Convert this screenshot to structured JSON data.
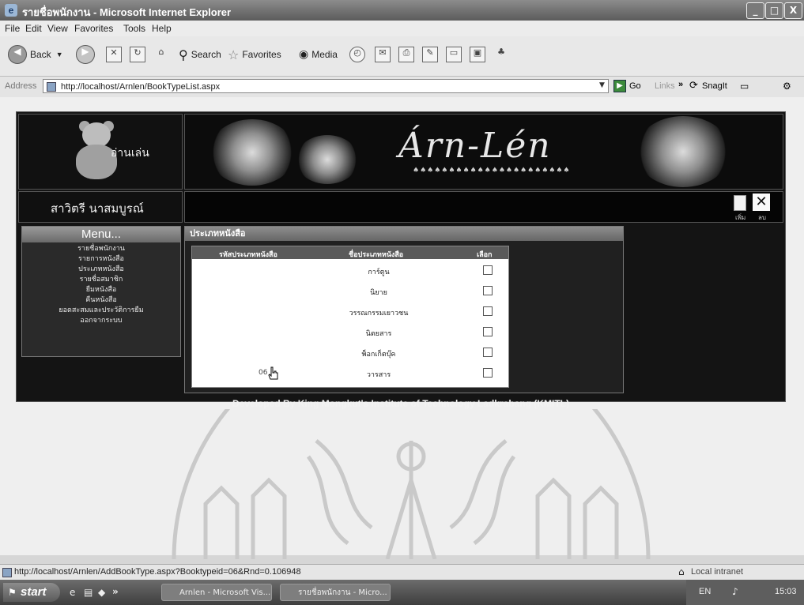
{
  "window": {
    "title": "รายชื่อพนักงาน - Microsoft Internet Explorer",
    "buttons": [
      "_",
      "□",
      "X"
    ]
  },
  "menubar": [
    "File",
    "Edit",
    "View",
    "Favorites",
    "Tools",
    "Help"
  ],
  "toolbar": {
    "back_label": "Back",
    "search_label": "Search",
    "favorites_label": "Favorites",
    "media_label": "Media"
  },
  "address": {
    "label": "Address",
    "url": "http://localhost/Arnlen/BookTypeList.aspx",
    "go_label": "Go",
    "links_label": "Links",
    "snagit_label": "SnagIt"
  },
  "site": {
    "logo_text": "อ่านเล่น",
    "banner_title": "Árn-Lén",
    "banner_dots": "♠♠♠♠♠♠♠♠♠♠♠♠♠♠♠♠♠♠♠♠♠♠",
    "user_name": "สาวิตรี นาสมบูรณ์",
    "add_label": "เพิ่ม",
    "delete_label": "ลบ",
    "menu_title": "Menu...",
    "menu_items": [
      "รายชื่อพนักงาน",
      "รายการหนังสือ",
      "ประเภทหนังสือ",
      "รายชื่อสมาชิก",
      "ยืมหนังสือ",
      "คืนหนังสือ",
      "ยอดสะสมและประวัติการยืม",
      "ออกจากระบบ"
    ],
    "content_title": "ประเภทหนังสือ",
    "table": {
      "headers": [
        "รหัสประเภทหนังสือ",
        "ชื่อประเภทหนังสือ",
        "เลือก"
      ],
      "rows": [
        {
          "name": "การ์ตูน",
          "selected": false
        },
        {
          "name": "นิยาย",
          "selected": false
        },
        {
          "name": "วรรณกรรมเยาวชน",
          "selected": false
        },
        {
          "name": "นิตยสาร",
          "selected": false
        },
        {
          "name": "พ็อกเก็ตบุ๊ค",
          "selected": false
        },
        {
          "name": "วารสาร",
          "selected": false
        }
      ],
      "last_row_code": "06"
    },
    "footer": "Developed By King Mongkut's Institute of Technology Ladkrabang (KMITL)"
  },
  "status": {
    "text": "http://localhost/Arnlen/AddBookType.aspx?Booktypeid=06&Rnd=0.106948",
    "zone": "Local intranet"
  },
  "taskbar": {
    "start_label": "start",
    "tasks": [
      "Arnlen - Microsoft Vis...",
      "รายชื่อพนักงาน - Micro..."
    ],
    "lang": "EN",
    "time": "15:03"
  }
}
